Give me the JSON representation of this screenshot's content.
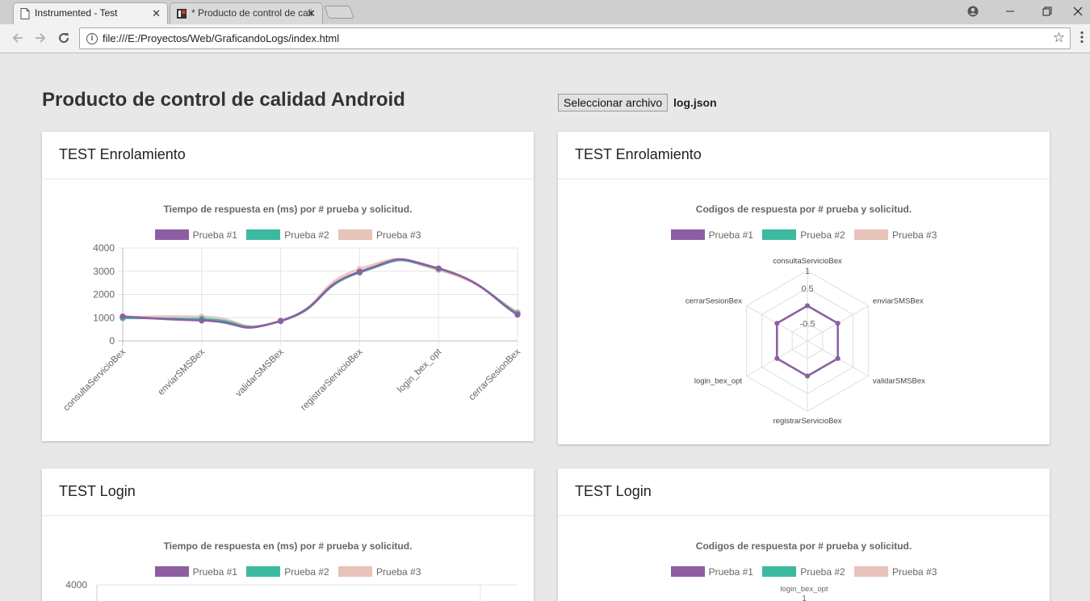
{
  "browser": {
    "tabs": [
      {
        "title": "Instrumented - Test",
        "active": true
      },
      {
        "title": "* Producto de control de calidad",
        "active": false
      }
    ],
    "close_glyph": "✕",
    "url": "file:///E:/Proyectos/Web/GraficandoLogs/index.html",
    "icons": [
      "page-icon",
      "app-icon",
      "account-icon",
      "minimize-icon",
      "restore-icon",
      "close-icon",
      "back-icon",
      "forward-icon",
      "reload-icon",
      "info-icon",
      "star-icon",
      "menu-icon"
    ]
  },
  "page": {
    "title": "Producto de control de calidad Android",
    "file_button": "Seleccionar archivo",
    "file_name": "log.json"
  },
  "colors": {
    "prueba1": "#8e5ea2",
    "prueba2": "#3cba9f",
    "prueba3": "#e8c3b9"
  },
  "cards": [
    {
      "header": "TEST Enrolamiento"
    },
    {
      "header": "TEST Enrolamiento"
    },
    {
      "header": "TEST Login"
    },
    {
      "header": "TEST Login"
    }
  ],
  "legend": [
    "Prueba #1",
    "Prueba #2",
    "Prueba #3"
  ],
  "chart_data": [
    {
      "type": "line",
      "title": "Tiempo de respuesta en (ms) por # prueba y solicitud.",
      "categories": [
        "consultaServicioBex",
        "enviarSMSBex",
        "validarSMSBex",
        "registrarServicioBex",
        "login_bex_opt",
        "cerrarSesionBex"
      ],
      "series": [
        {
          "name": "Prueba #1",
          "values": [
            1050,
            880,
            860,
            2980,
            3120,
            1130
          ]
        },
        {
          "name": "Prueba #2",
          "values": [
            980,
            950,
            850,
            2940,
            3100,
            1180
          ]
        },
        {
          "name": "Prueba #3",
          "values": [
            1020,
            1050,
            870,
            3100,
            3050,
            1250
          ]
        }
      ],
      "y_ticks": [
        "4000",
        "3000",
        "2000",
        "1000",
        "0"
      ],
      "ylim": [
        0,
        4000
      ],
      "grid": true,
      "legend_position": "top"
    },
    {
      "type": "radar",
      "title": "Codigos de respuesta por # prueba y solicitud.",
      "categories": [
        "consultaServicioBex",
        "enviarSMSBex",
        "validarSMSBex",
        "registrarServicioBex",
        "login_bex_opt",
        "cerrarSesionBex"
      ],
      "series": [
        {
          "name": "Prueba #1",
          "values": [
            0,
            0,
            0,
            0,
            0,
            0
          ]
        },
        {
          "name": "Prueba #2",
          "values": [
            0,
            0,
            0,
            0,
            0,
            0
          ]
        },
        {
          "name": "Prueba #3",
          "values": [
            0,
            0,
            0,
            0,
            0,
            0
          ]
        }
      ],
      "r_ticks": [
        "1",
        "0.5",
        "-0.5"
      ],
      "rlim": [
        -1,
        1
      ],
      "legend_position": "top"
    },
    {
      "type": "line",
      "title": "Tiempo de respuesta en (ms) por # prueba y solicitud.",
      "y_ticks": [
        "4000"
      ],
      "legend_position": "top"
    },
    {
      "type": "radar",
      "title": "Codigos de respuesta por # prueba y solicitud.",
      "categories": [
        "login_bex_opt"
      ],
      "r_ticks": [
        "1"
      ],
      "legend_position": "top"
    }
  ]
}
